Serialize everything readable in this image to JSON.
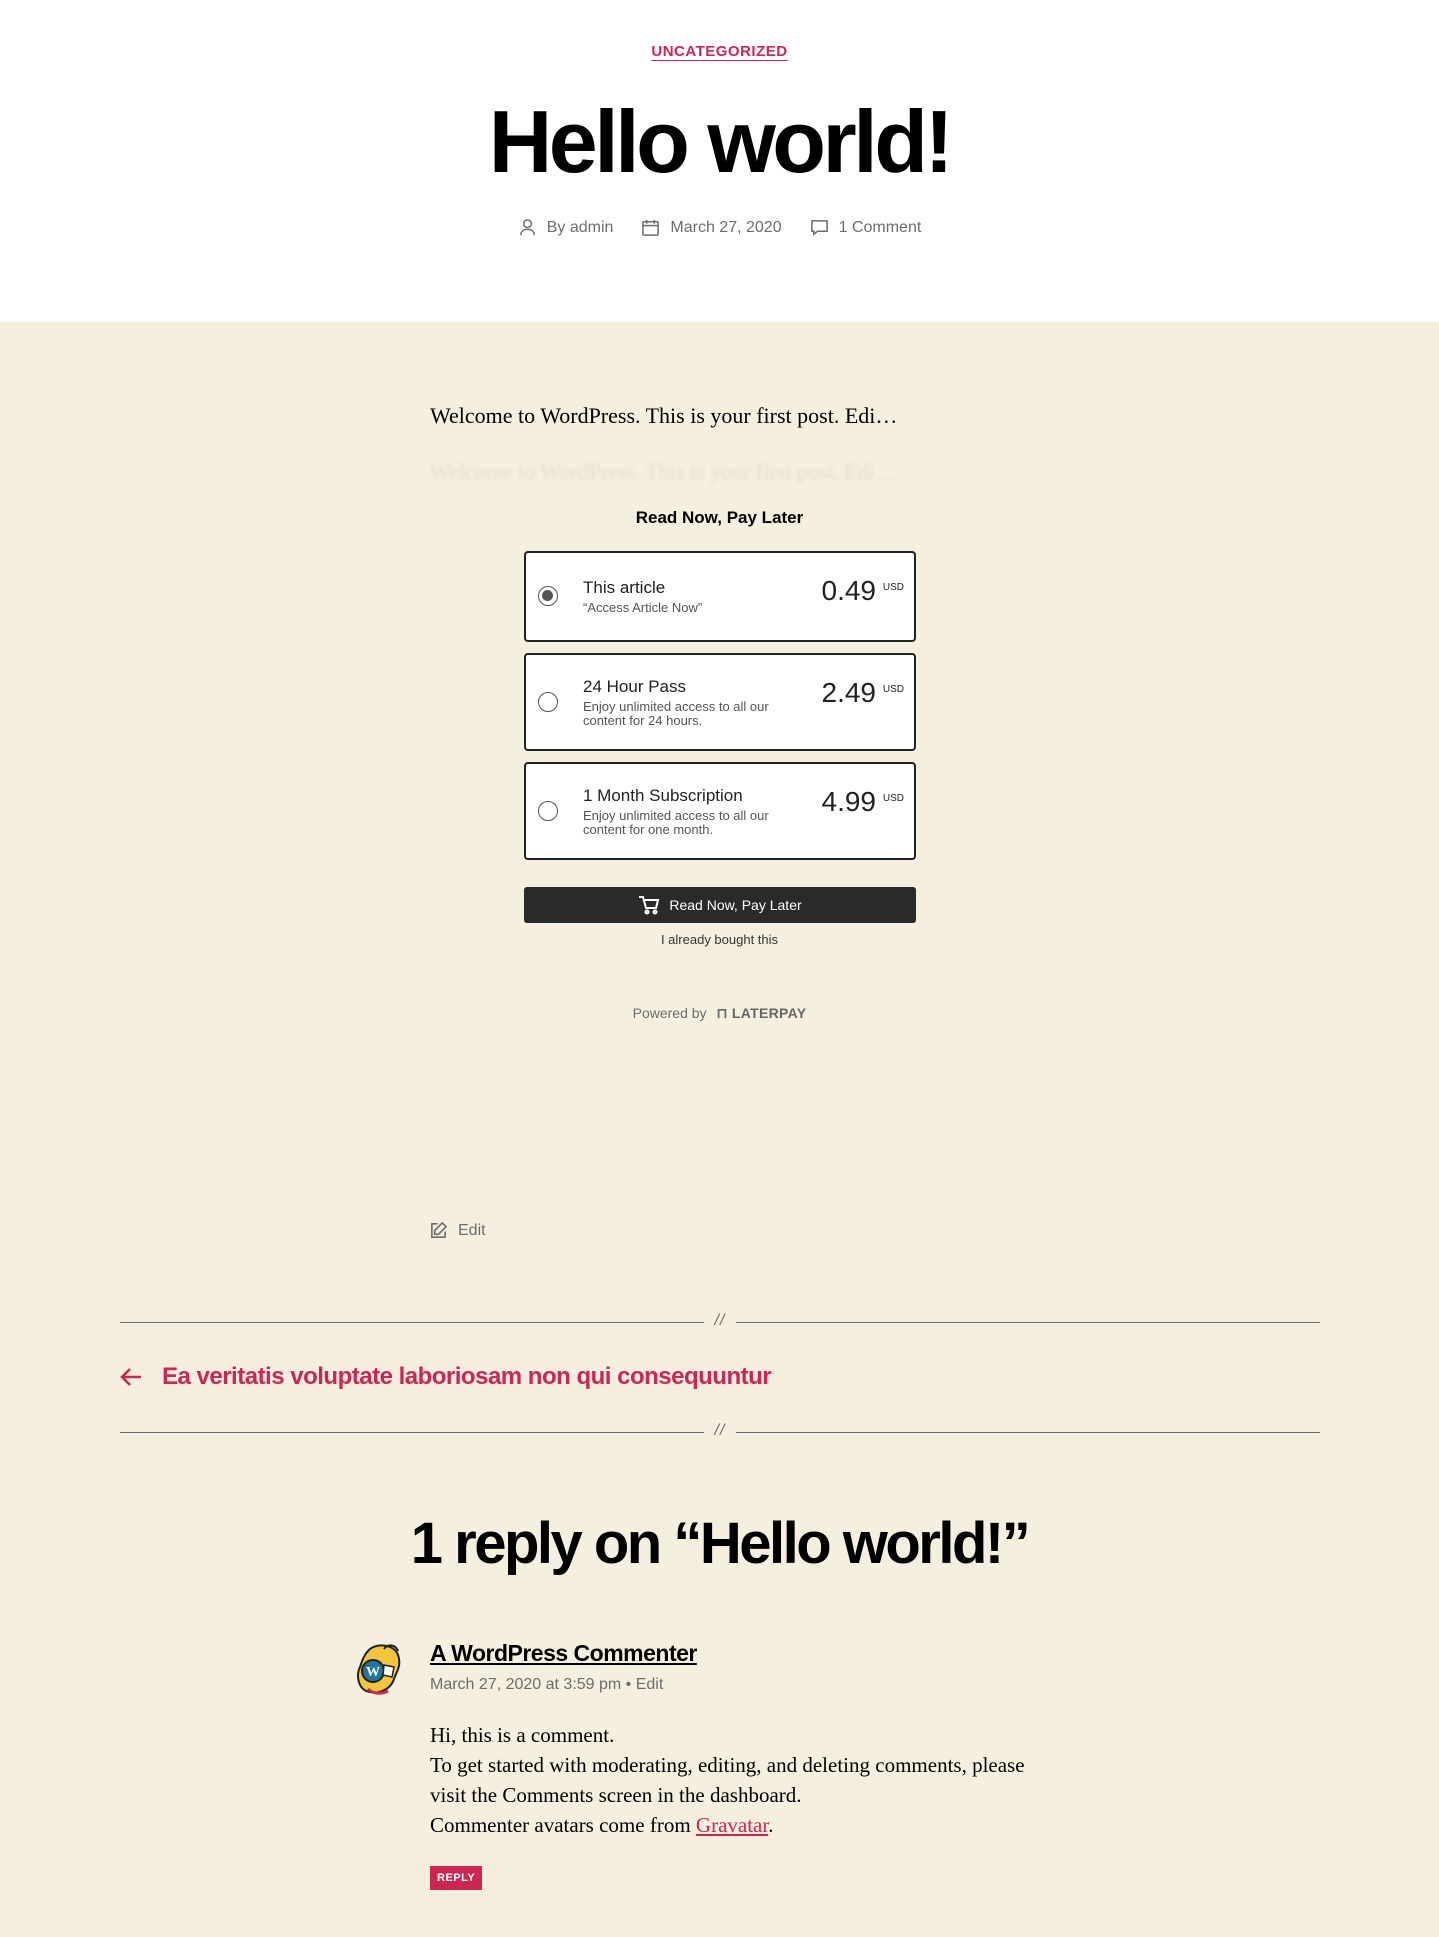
{
  "post": {
    "category": "UNCATEGORIZED",
    "title": "Hello world!",
    "author": "By admin",
    "date": "March 27, 2020",
    "comments_count": "1 Comment",
    "excerpt": "Welcome to WordPress. This is your first post. Edi…",
    "excerpt_faded": "Welcome to WordPress. This is your first post. Edi…",
    "edit_label": "Edit"
  },
  "paywall": {
    "heading": "Read Now, Pay Later",
    "options": [
      {
        "title": "This article",
        "description": "“Access Article Now”",
        "price": "0.49",
        "currency": "USD",
        "selected": true
      },
      {
        "title": "24 Hour Pass",
        "description": "Enjoy unlimited access to all our content for 24 hours.",
        "price": "2.49",
        "currency": "USD",
        "selected": false
      },
      {
        "title": "1 Month Subscription",
        "description": "Enjoy unlimited access to all our content for one month.",
        "price": "4.99",
        "currency": "USD",
        "selected": false
      }
    ],
    "button_label": "Read Now, Pay Later",
    "already_bought": "I already bought this",
    "powered_by": "Powered by",
    "brand": "LATERPAY"
  },
  "navigation": {
    "separator": "//",
    "previous_post": "Ea veritatis voluptate laboriosam non qui consequuntur"
  },
  "comments": {
    "title": "1 reply on “Hello world!”",
    "items": [
      {
        "author": "A WordPress Commenter",
        "date": "March 27, 2020 at 3:59 pm",
        "meta_sep": " • ",
        "edit": "Edit",
        "body_line1": "Hi, this is a comment.",
        "body_line2": "To get started with moderating, editing, and deleting comments, please visit the Comments screen in the dashboard.",
        "body_line3_prefix": "Commenter avatars come from ",
        "body_link": "Gravatar",
        "body_line3_suffix": ".",
        "reply_label": "REPLY"
      }
    ]
  },
  "colors": {
    "accent": "#cd2653",
    "background": "#f5efe0",
    "meta_text": "#6d6d6d"
  }
}
